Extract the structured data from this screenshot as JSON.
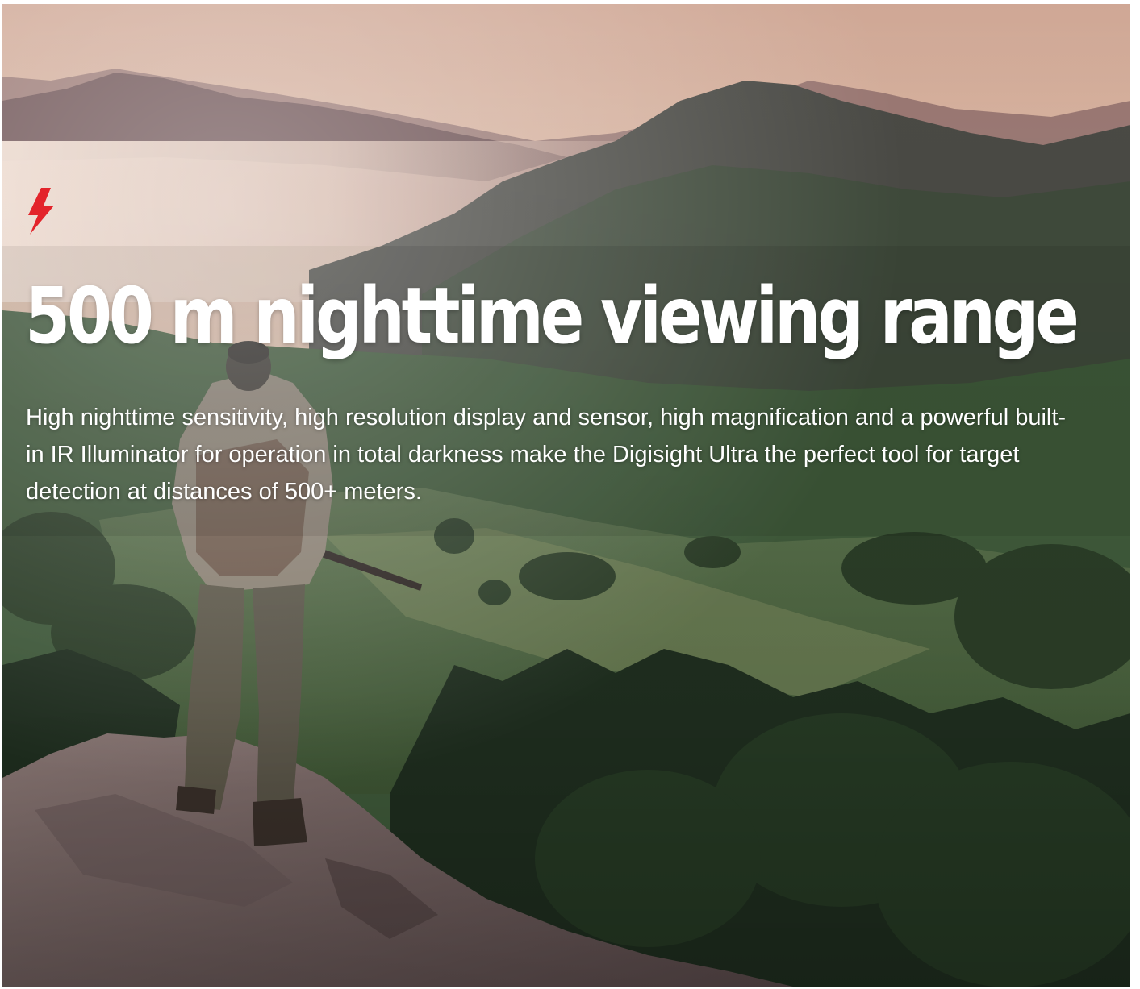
{
  "hero": {
    "icon": "lightning-bolt-icon",
    "accent_color": "#e3242b",
    "title": "500 m nighttime viewing range",
    "description": "High nighttime sensitivity, high resolution display and sensor, high magnification and a powerful built-in IR Illuminator for operation in total darkness make the Digisight Ultra the perfect tool for target detection at distances of 500+ meters."
  }
}
